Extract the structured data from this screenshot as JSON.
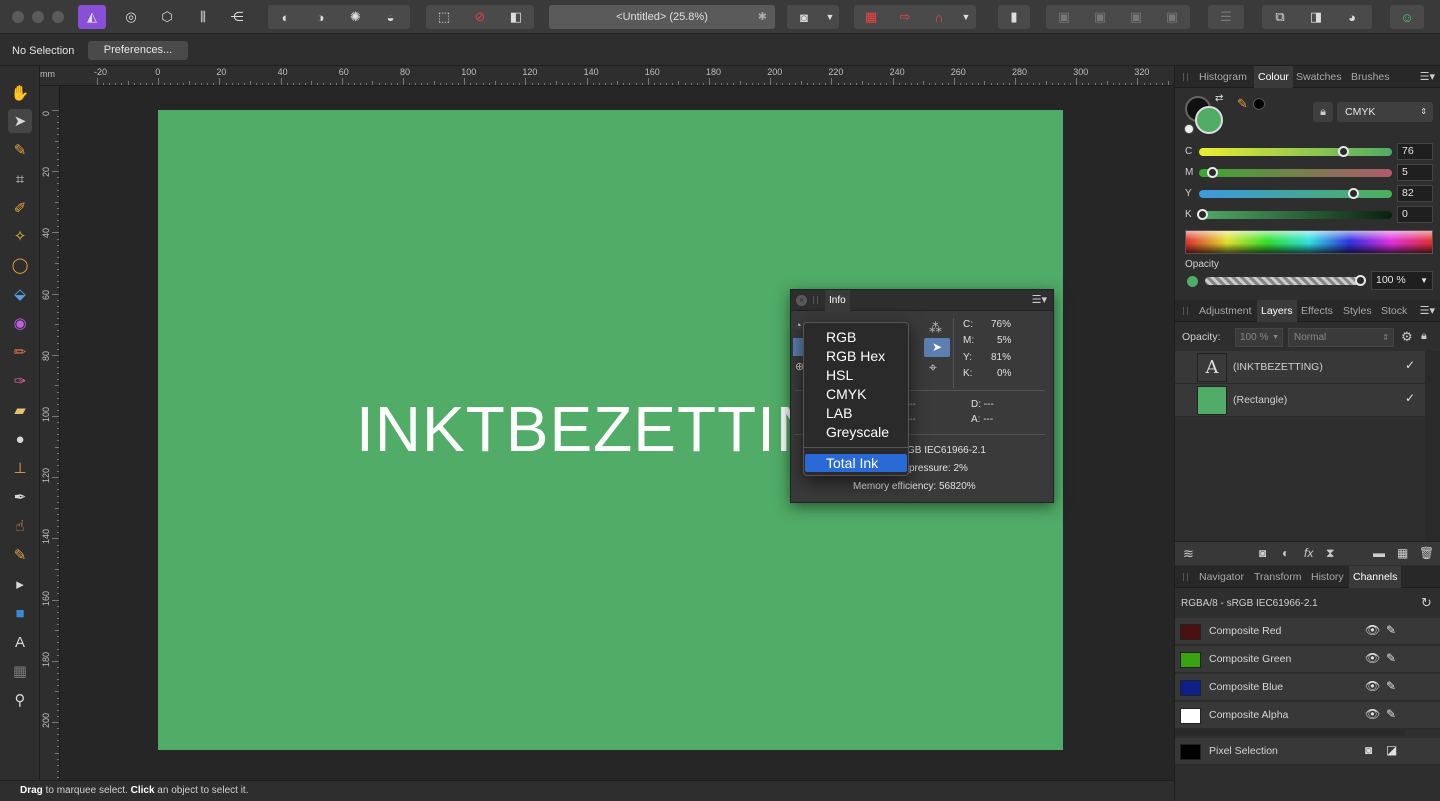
{
  "toolbar": {
    "document_title": "<Untitled> (25.8%)",
    "star": "✱"
  },
  "context": {
    "selection": "No Selection",
    "preferences": "Preferences..."
  },
  "status": {
    "drag_bold": "Drag",
    "drag_text": " to marquee select. ",
    "click_bold": "Click",
    "click_text": " an object to select it."
  },
  "ruler": {
    "unit": "mm",
    "top_labels": [
      "-20",
      "0",
      "20",
      "40",
      "60",
      "80",
      "100",
      "120",
      "140",
      "160",
      "180",
      "200",
      "220",
      "240",
      "260",
      "280",
      "300",
      "320"
    ],
    "left_labels": [
      "0",
      "20",
      "40",
      "60",
      "80",
      "100",
      "120",
      "140",
      "160",
      "180",
      "200"
    ]
  },
  "canvas": {
    "artboard_color": "#50ac66",
    "text": "INKTBEZETTIN"
  },
  "info_panel": {
    "tab": "Info",
    "c": "C:",
    "c_val": "76%",
    "m": "M:",
    "m_val": "5%",
    "y": "Y:",
    "y_val": "81%",
    "k": "K:",
    "k_val": "0%",
    "d": "D: ---",
    "a": "A: ---",
    "dash": "--",
    "profile_partial": "GB IEC61966-2.1",
    "pressure_partial": "pressure: 2%",
    "memory": "Memory efficiency: 56820%"
  },
  "dropdown": {
    "items": [
      "RGB",
      "RGB Hex",
      "HSL",
      "CMYK",
      "LAB",
      "Greyscale"
    ],
    "selected": "Total Ink"
  },
  "colour_panel": {
    "tabs": [
      "Histogram",
      "Colour",
      "Swatches",
      "Brushes"
    ],
    "active_tab": "Colour",
    "model": "CMYK",
    "fill_color": "#50ac66",
    "c_label": "C",
    "c_value": "76",
    "m_label": "M",
    "m_value": "5",
    "y_label": "Y",
    "y_value": "82",
    "k_label": "K",
    "k_value": "0",
    "opacity_label": "Opacity",
    "opacity_value": "100 %"
  },
  "layers_panel": {
    "tabs": [
      "Adjustment",
      "Layers",
      "Effects",
      "Styles",
      "Stock"
    ],
    "active_tab": "Layers",
    "opacity_label": "Opacity:",
    "opacity_value": "100 %",
    "blend_mode": "Normal",
    "layers": [
      {
        "name": "(INKTBEZETTING)",
        "thumb": "A"
      },
      {
        "name": "(Rectangle)",
        "thumb": ""
      }
    ]
  },
  "channels_panel": {
    "tabs": [
      "Navigator",
      "Transform",
      "History",
      "Channels"
    ],
    "active_tab": "Channels",
    "format": "RGBA/8 - sRGB IEC61966-2.1",
    "channels": [
      {
        "name": "Composite Red",
        "color": "#4a0f0f"
      },
      {
        "name": "Composite Green",
        "color": "#3aa312"
      },
      {
        "name": "Composite Blue",
        "color": "#0f1f8a"
      },
      {
        "name": "Composite Alpha",
        "color": "#ffffff"
      }
    ],
    "pixel_selection": "Pixel Selection"
  }
}
